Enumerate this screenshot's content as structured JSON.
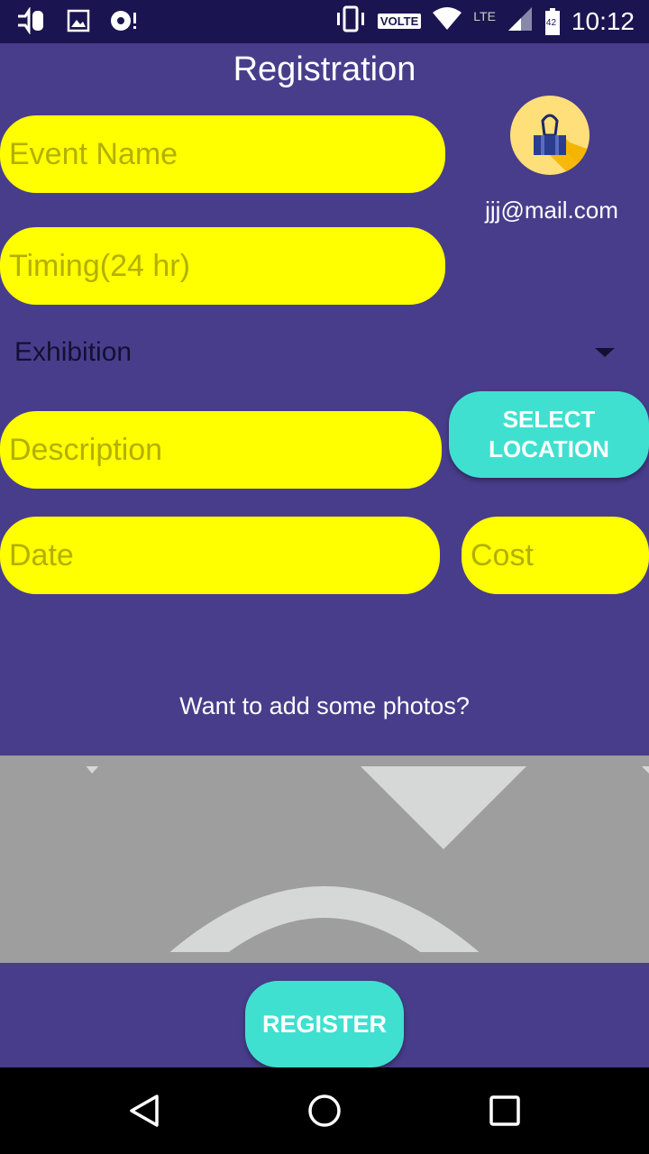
{
  "status_bar": {
    "network_badge": "VOLTE",
    "lte": "LTE",
    "battery_level": "42",
    "time": "10:12",
    "icons": [
      "usb-debug-icon",
      "image-icon",
      "media-icon",
      "vibrate-icon",
      "wifi-icon",
      "signal-icon",
      "battery-icon"
    ]
  },
  "header": {
    "title": "Registration"
  },
  "form": {
    "event_name_placeholder": "Event Name",
    "timing_placeholder": "Timing(24 hr)",
    "category_selected": "Exhibition",
    "description_placeholder": "Description",
    "date_placeholder": "Date",
    "cost_placeholder": "Cost",
    "select_location_line1": "SELECT",
    "select_location_line2": "LOCATION"
  },
  "profile": {
    "email": "jjj@mail.com",
    "avatar_icon": "binder-clip-icon"
  },
  "photos": {
    "prompt": "Want to add some photos?",
    "placeholder_icon": "image-placeholder-icon"
  },
  "actions": {
    "register_label": "REGISTER"
  },
  "colors": {
    "background": "#483d8b",
    "input_fill": "#ffff00",
    "input_placeholder": "#b3b000",
    "accent": "#40e0d0",
    "status_bar": "#1a1550"
  }
}
